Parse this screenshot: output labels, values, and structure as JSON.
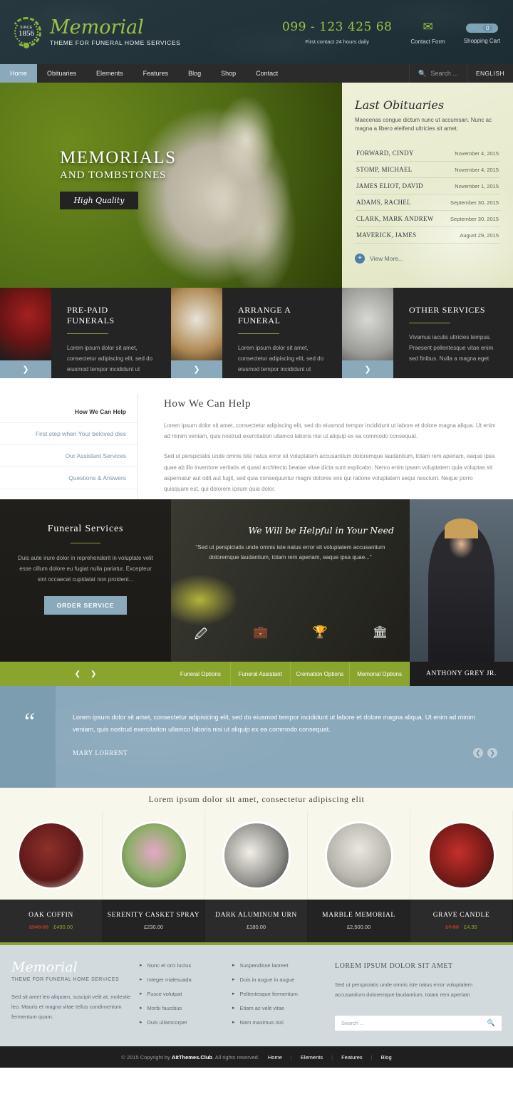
{
  "header": {
    "logo": {
      "since_label": "SINCE",
      "since_year": "1856",
      "name": "Memorial",
      "tagline": "THEME FOR FUNERAL HOME SERVICES"
    },
    "phone": "099 - 123 425 68",
    "phone_note": "First contact 24 hours daily",
    "contact_form_label": "Contact Form",
    "cart_label": "Shopping Cart",
    "cart_count": "0"
  },
  "nav": {
    "items": [
      {
        "label": "Home",
        "active": true
      },
      {
        "label": "Obituaries",
        "active": false
      },
      {
        "label": "Elements",
        "active": false
      },
      {
        "label": "Features",
        "active": false
      },
      {
        "label": "Blog",
        "active": false
      },
      {
        "label": "Shop",
        "active": false
      },
      {
        "label": "Contact",
        "active": false
      }
    ],
    "search_placeholder": "Search ...",
    "language": "ENGLISH"
  },
  "hero": {
    "title": "MEMORIALS",
    "subtitle": "AND TOMBSTONES",
    "button": "High Quality"
  },
  "obituaries": {
    "title": "Last Obituaries",
    "description": "Maecenas congue dictum nunc ut accumsan. Nunc ac magna a libero eleifend ultricies sit amet.",
    "entries": [
      {
        "name": "FORWARD, CINDY",
        "date": "November 4, 2015"
      },
      {
        "name": "STOMP, MICHAEL",
        "date": "November 4, 2015"
      },
      {
        "name": "JAMES ELIOT, DAVID",
        "date": "November 1, 2015"
      },
      {
        "name": "ADAMS, RACHEL",
        "date": "September 30, 2015"
      },
      {
        "name": "CLARK, MARK ANDREW",
        "date": "September 30, 2015"
      },
      {
        "name": "MAVERICK, JAMES",
        "date": "August 29, 2015"
      }
    ],
    "view_more": "View More..."
  },
  "services": [
    {
      "title": "PRE-PAID FUNERALS",
      "text": "Lorem ipsum dolor sit amet, consectetur adipiscing elit, sed do eiusmod tempor incididunt ut"
    },
    {
      "title": "ARRANGE A FUNERAL",
      "text": "Lorem ipsum dolor sit amet, consectetur adipiscing elit, sed do eiusmod tempor incididunt ut"
    },
    {
      "title": "OTHER SERVICES",
      "text": "Vivamus iaculis ultricies tempus. Praesent pellentesque vitae enim sed finibus. Nulla a magna eget"
    }
  ],
  "help": {
    "tabs": [
      {
        "label": "How We Can Help",
        "active": true
      },
      {
        "label": "First step when Your beloved dies",
        "active": false
      },
      {
        "label": "Our Assistant Services",
        "active": false
      },
      {
        "label": "Questions & Answers",
        "active": false
      }
    ],
    "heading": "How We Can Help",
    "paragraph1": "Lorem ipsum dolor sit amet, consectetur adipiscing elit, sed do eiusmod tempor incididunt ut labore et dolore magna aliqua. Ut enim ad minim veniam, quis nostrud exercitation ullamco laboris nisi ut aliquip ex ea commodo consequat.",
    "paragraph2": "Sed ut perspiciatis unde omnis iste natus error sit voluptatem accusantium doloremque laudantium, totam rem aperiam, eaque ipsa quae ab illo inventore veritatis et quasi architecto beatae vitae dicta sunt explicabo. Nemo enim ipsam voluptatem quia voluptas sit aspernatur aut odit aut fugit, sed quia consequuntur magni dolores eos qui ratione voluptatem sequi nesciunt. Neque porro quisquam est, qui dolorem ipsum quia dolor."
  },
  "feature": {
    "heading": "Funeral Services",
    "text": "Duis aute irure dolor in reprehenderit in voluptate velit esse cillum dolore eu fugiat nulla pariatur. Excepteur sint occaecat cupidatat non proident...",
    "button": "ORDER SERVICE",
    "quote_title": "We Will be Helpful in Your Need",
    "quote_text": "\"Sed ut perspiciatis unde omnis iste natus error sit voluptatem accusantium doloremque laudantium, totam rem aperiam, eaque ipsa quae...\"",
    "icons": [
      "pencil-edit-icon",
      "briefcase-icon",
      "trophy-icon",
      "bank-icon"
    ],
    "tabs": [
      "Funeral Options",
      "Funeral Assistant",
      "Cremation Options",
      "Memorial Options"
    ],
    "person_name": "ANTHONY GREY JR."
  },
  "testimonial": {
    "text": "Lorem ipsum dolor sit amet, consectetur adipisicing elit, sed do eiusmod tempor incididunt ut labore et dolore magna aliqua. Ut enim ad minim veniam, quis nostrud exercitation ullamco laboris nisi ut aliquip ex ea commodo consequat.",
    "author": "MARY LORRENT"
  },
  "products": {
    "heading": "Lorem ipsum dolor sit amet, consectetur adipiscing elit",
    "items": [
      {
        "name": "OAK COFFIN",
        "old_price": "£540.00",
        "price": "£490.00",
        "on_sale": true
      },
      {
        "name": "SERENITY CASKET SPRAY",
        "old_price": "",
        "price": "£230.00",
        "on_sale": false
      },
      {
        "name": "DARK ALUMINUM URN",
        "old_price": "",
        "price": "£180.00",
        "on_sale": false
      },
      {
        "name": "MARBLE MEMORIAL",
        "old_price": "",
        "price": "£2,500.00",
        "on_sale": false
      },
      {
        "name": "GRAVE CANDLE",
        "old_price": "£7.00",
        "price": "£4.95",
        "on_sale": true
      }
    ]
  },
  "footer": {
    "brand": "Memorial",
    "brand_sub": "THEME FOR FUNERAL HOME SERVICES",
    "about": "Sed sit amet leo aliquam, suscipit velit at, molestie leo. Mauris et magna vitae tellus condimentum fermentum quam.",
    "links_col1": [
      "Nunc et orci luctus",
      "Integer malesuada",
      "Fusce volutpat",
      "Morbi faucibus",
      "Duis ullamcorper"
    ],
    "links_col2": [
      "Suspendisse laoreet",
      "Duis in augue in augue",
      "Pellentesque fermentum",
      "Etiam ac velit vitae",
      "Nam maximus nisi"
    ],
    "widget_title": "LOREM IPSUM DOLOR SIT AMET",
    "widget_text": "Sed ut perspiciatis unde omnis iste natus error voluptatem accusantium doloremque laudantium, totam rem aperiam",
    "search_placeholder": "Search ..."
  },
  "copyright": {
    "prefix": "© 2015 Copyright by ",
    "brand": "AitThemes.Club",
    "suffix": ". All rights reserved.",
    "links": [
      "Home",
      "Elements",
      "Features",
      "Blog"
    ]
  }
}
